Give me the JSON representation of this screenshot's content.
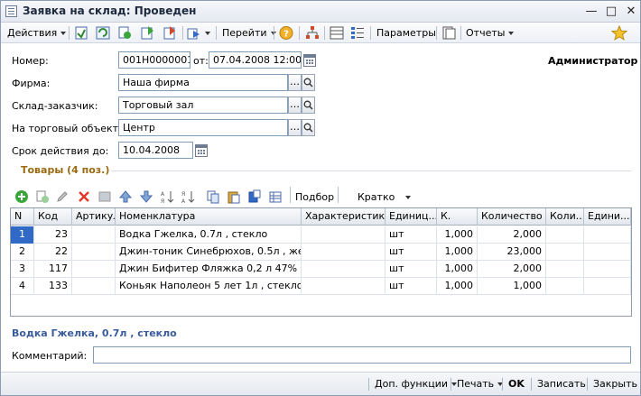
{
  "window": {
    "title": "Заявка на склад: Проведен"
  },
  "toolbar": {
    "actions_label": "Действия",
    "goto_label": "Перейти",
    "params_label": "Параметры",
    "reports_label": "Отчеты"
  },
  "header": {
    "number_label": "Номер:",
    "number_value": "001Н0000001",
    "from_label": "от:",
    "date_value": "07.04.2008 12:00:00",
    "user": "Администратор",
    "firm_label": "Фирма:",
    "firm_value": "Наша фирма",
    "warehouse_label": "Склад-заказчик:",
    "warehouse_value": "Торговый зал",
    "object_label": "На торговый объект:",
    "object_value": "Центр",
    "validity_label": "Срок действия до:",
    "validity_value": "10.04.2008"
  },
  "goods": {
    "section_title": "Товары (4 поз.)",
    "pick_label": "Подбор",
    "view_mode_label": "Кратко",
    "columns": [
      "N",
      "Код",
      "Артикул",
      "Номенклатура",
      "Характеристика",
      "Единиц...",
      "К.",
      "Количество",
      "Коли...",
      "Едини..."
    ],
    "rows": [
      {
        "n": "1",
        "code": "23",
        "article": "",
        "name": "Водка  Гжелка,  0.7л , стекло",
        "char": "",
        "unit": "шт",
        "k": "1,000",
        "qty": "2,000",
        "qty2": "",
        "unit2": ""
      },
      {
        "n": "2",
        "code": "22",
        "article": "",
        "name": "Джин-тоник Синебрюхов, 0.5л , жесть",
        "char": "",
        "unit": "шт",
        "k": "1,000",
        "qty": "23,000",
        "qty2": "",
        "unit2": ""
      },
      {
        "n": "3",
        "code": "117",
        "article": "",
        "name": "Джин Бифитер Фляжка 0,2 л 47%",
        "char": "",
        "unit": "шт",
        "k": "1,000",
        "qty": "2,000",
        "qty2": "",
        "unit2": ""
      },
      {
        "n": "4",
        "code": "133",
        "article": "",
        "name": "Коньяк  Наполеон 5 лет 1л , стекло",
        "char": "",
        "unit": "шт",
        "k": "1,000",
        "qty": "1,000",
        "qty2": "",
        "unit2": ""
      }
    ],
    "current_item": "Водка  Гжелка,  0.7л , стекло"
  },
  "comment": {
    "label": "Комментарий:",
    "value": ""
  },
  "bottom": {
    "extra_label": "Доп. функции",
    "print_label": "Печать",
    "ok_label": "OK",
    "save_label": "Записать",
    "close_label": "Закрыть"
  }
}
